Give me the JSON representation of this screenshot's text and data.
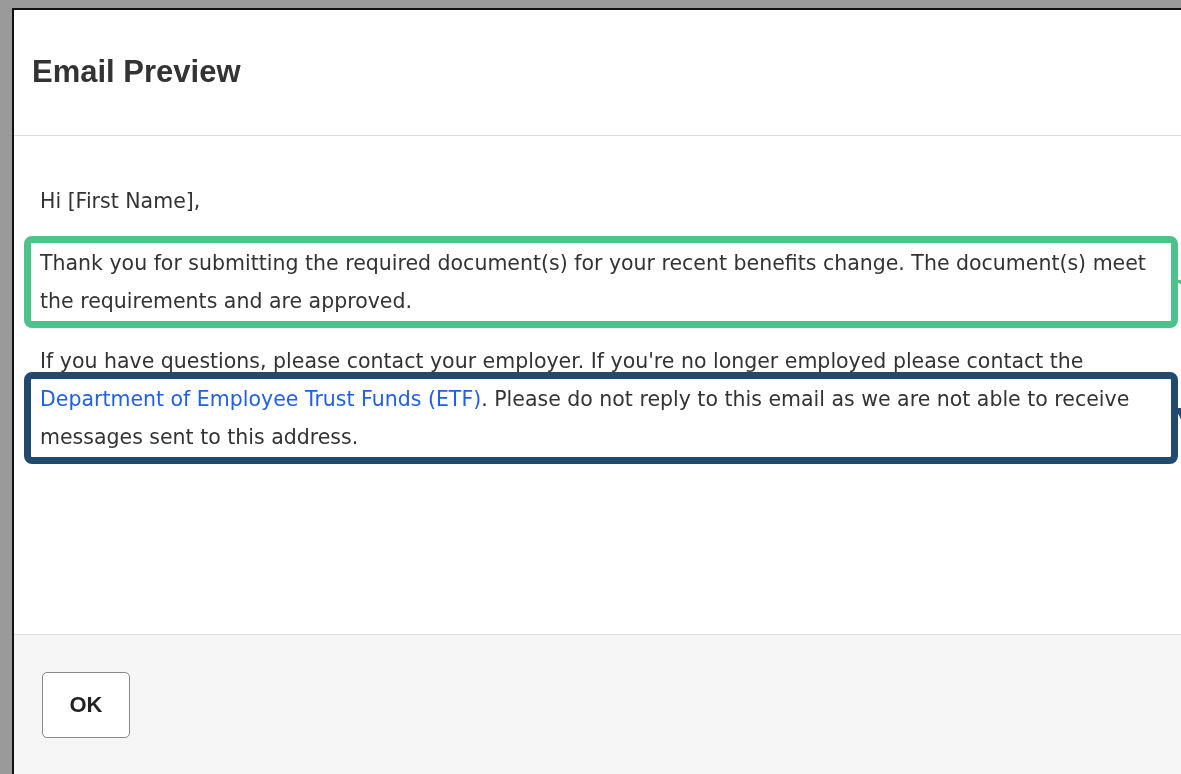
{
  "dialog": {
    "title": "Email Preview"
  },
  "email": {
    "greeting": "Hi [First Name],",
    "paragraphs": [
      {
        "text": "Thank you for submitting the required document(s) for your recent benefits change. The document(s) meet the requirements and are approved.",
        "color": "#4cc38a"
      },
      {
        "text": "If you have questions, please contact your employer. If you're no longer employed please contact the ",
        "link": "Department of Employee Trust Funds (ETF)",
        "text_after": ". Please do not reply to this email as we are not able to receive messages sent to this address.",
        "color": "#224a6e"
      }
    ]
  },
  "buttons": [
    {
      "label": "OK"
    }
  ]
}
